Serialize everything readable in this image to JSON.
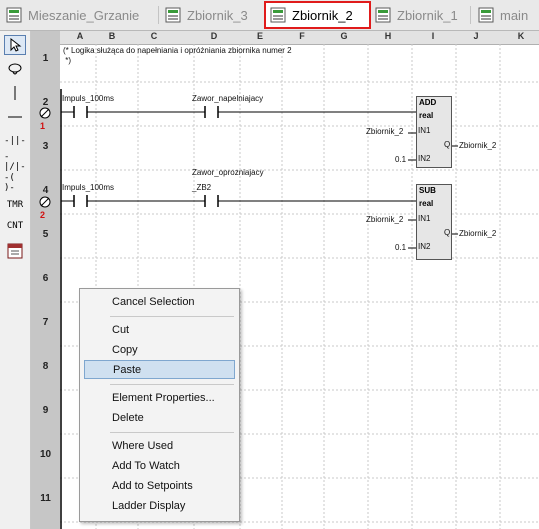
{
  "tabs": [
    {
      "label": "Mieszanie_Grzanie",
      "active": false
    },
    {
      "label": "Zbiornik_3",
      "active": false
    },
    {
      "label": "Zbiornik_2",
      "active": true
    },
    {
      "label": "Zbiornik_1",
      "active": false
    },
    {
      "label": "main",
      "active": false
    }
  ],
  "tools": [
    "pointer-tool",
    "coil-tool",
    "line-tool",
    "-||-",
    "-|/|-",
    "-( )-",
    "TMR",
    "CNT",
    "table-tool"
  ],
  "columns": [
    "A",
    "B",
    "C",
    "D",
    "E",
    "F",
    "G",
    "H",
    "I",
    "J",
    "K"
  ],
  "rows": [
    "1",
    "2",
    "3",
    "4",
    "5",
    "6",
    "7",
    "8",
    "9",
    "10",
    "11"
  ],
  "rung_markers": [
    "1",
    "2"
  ],
  "comment": "(* Logika służąca do napełniania i opróżniania zbiornika numer 2\n *)",
  "rung1": {
    "contact1": "Impuls_100ms",
    "contact2": "Zawor_napelniajacy",
    "block": {
      "type": "ADD",
      "subtype": "real",
      "in1_label": "IN1",
      "in2_label": "IN2",
      "out_label": "Q",
      "in1": "Zbiornik_2",
      "in2": "0.1",
      "out": "Zbiornik_2"
    }
  },
  "rung2": {
    "contact1": "Impuls_100ms",
    "contact2_line1": "Zawor_oprozniajacy",
    "contact2_line2": "_ZB2",
    "block": {
      "type": "SUB",
      "subtype": "real",
      "in1_label": "IN1",
      "in2_label": "IN2",
      "out_label": "Q",
      "in1": "Zbiornik_2",
      "in2": "0.1",
      "out": "Zbiornik_2"
    }
  },
  "context_menu": {
    "cancel_selection": "Cancel Selection",
    "cut": "Cut",
    "copy": "Copy",
    "paste": "Paste",
    "element_properties": "Element Properties...",
    "delete": "Delete",
    "where_used": "Where Used",
    "add_to_watch": "Add To Watch",
    "add_to_setpoints": "Add to Setpoints",
    "ladder_display": "Ladder Display"
  }
}
